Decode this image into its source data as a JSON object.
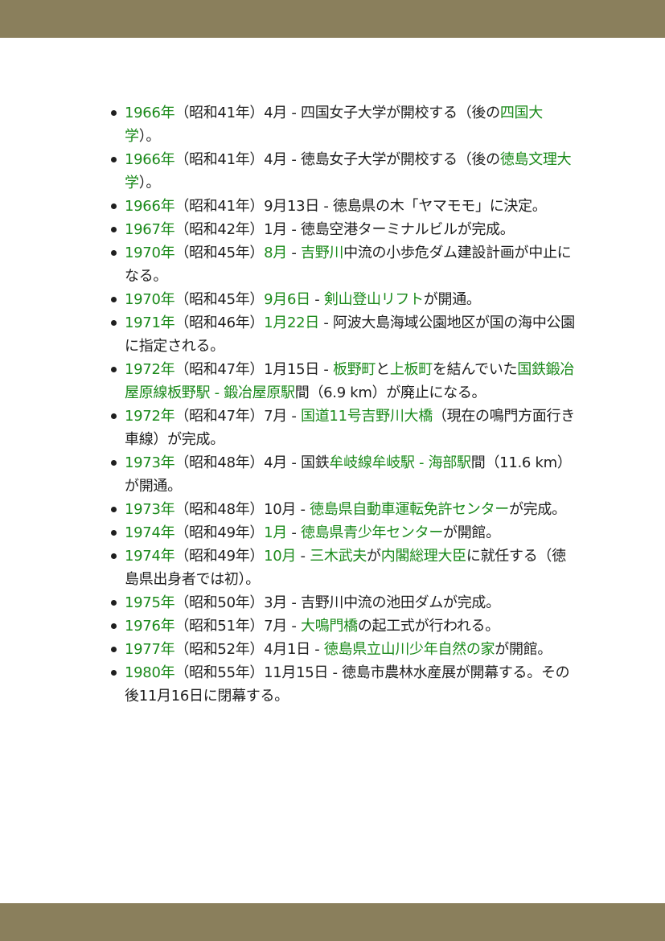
{
  "timeline": {
    "entries": [
      {
        "segments": [
          {
            "text": "1966年",
            "link": true
          },
          {
            "text": "（昭和41年）4月 - 四国女子大学が開校する（後の"
          },
          {
            "text": "四国大学",
            "link": true
          },
          {
            "text": "）。"
          }
        ]
      },
      {
        "segments": [
          {
            "text": "1966年",
            "link": true
          },
          {
            "text": "（昭和41年）4月 - 徳島女子大学が開校する（後の"
          },
          {
            "text": "徳島文理大学",
            "link": true
          },
          {
            "text": "）。"
          }
        ]
      },
      {
        "segments": [
          {
            "text": "1966年",
            "link": true
          },
          {
            "text": "（昭和41年）9月13日 - 徳島県の木「ヤマモモ」に決定。"
          }
        ]
      },
      {
        "segments": [
          {
            "text": "1967年",
            "link": true
          },
          {
            "text": "（昭和42年）1月 - 徳島空港ターミナルビルが完成。"
          }
        ]
      },
      {
        "segments": [
          {
            "text": "1970年",
            "link": true
          },
          {
            "text": "（昭和45年）"
          },
          {
            "text": "8月",
            "link": true
          },
          {
            "text": " - "
          },
          {
            "text": "吉野川",
            "link": true
          },
          {
            "text": "中流の小歩危ダム建設計画が中止になる。"
          }
        ]
      },
      {
        "segments": [
          {
            "text": "1970年",
            "link": true
          },
          {
            "text": "（昭和45年）"
          },
          {
            "text": "9月6日",
            "link": true
          },
          {
            "text": " - "
          },
          {
            "text": "剣山登山リフト",
            "link": true
          },
          {
            "text": "が開通。"
          }
        ]
      },
      {
        "segments": [
          {
            "text": "1971年",
            "link": true
          },
          {
            "text": "（昭和46年）"
          },
          {
            "text": "1月22日",
            "link": true
          },
          {
            "text": " - 阿波大島海域公園地区が国の海中公園に指定される。"
          }
        ]
      },
      {
        "segments": [
          {
            "text": "1972年",
            "link": true
          },
          {
            "text": "（昭和47年）1月15日 - "
          },
          {
            "text": "板野町",
            "link": true
          },
          {
            "text": "と"
          },
          {
            "text": "上板町",
            "link": true
          },
          {
            "text": "を結んでいた"
          },
          {
            "text": "国鉄鍛冶屋原線板野駅 - 鍛冶屋原駅",
            "link": true
          },
          {
            "text": "間（6.9 km）が廃止になる。"
          }
        ]
      },
      {
        "segments": [
          {
            "text": "1972年",
            "link": true
          },
          {
            "text": "（昭和47年）7月 - "
          },
          {
            "text": "国道11号吉野川大橋",
            "link": true
          },
          {
            "text": "（現在の鳴門方面行き車線）が完成。"
          }
        ]
      },
      {
        "segments": [
          {
            "text": "1973年",
            "link": true
          },
          {
            "text": "（昭和48年）4月 - 国鉄"
          },
          {
            "text": "牟岐線牟岐駅 - 海部駅",
            "link": true
          },
          {
            "text": "間（11.6 km）が開通。"
          }
        ]
      },
      {
        "segments": [
          {
            "text": "1973年",
            "link": true
          },
          {
            "text": "（昭和48年）10月 - "
          },
          {
            "text": "徳島県自動車運転免許センター",
            "link": true
          },
          {
            "text": "が完成。"
          }
        ]
      },
      {
        "segments": [
          {
            "text": "1974年",
            "link": true
          },
          {
            "text": "（昭和49年）"
          },
          {
            "text": "1月",
            "link": true
          },
          {
            "text": " - "
          },
          {
            "text": "徳島県青少年センター",
            "link": true
          },
          {
            "text": "が開館。"
          }
        ]
      },
      {
        "segments": [
          {
            "text": "1974年",
            "link": true
          },
          {
            "text": "（昭和49年）"
          },
          {
            "text": "10月",
            "link": true
          },
          {
            "text": " - "
          },
          {
            "text": "三木武夫",
            "link": true
          },
          {
            "text": "が"
          },
          {
            "text": "内閣総理大臣",
            "link": true
          },
          {
            "text": "に就任する（徳島県出身者では初）。"
          }
        ]
      },
      {
        "segments": [
          {
            "text": "1975年",
            "link": true
          },
          {
            "text": "（昭和50年）3月 - 吉野川中流の池田ダムが完成。"
          }
        ]
      },
      {
        "segments": [
          {
            "text": "1976年",
            "link": true
          },
          {
            "text": "（昭和51年）7月 - "
          },
          {
            "text": "大鳴門橋",
            "link": true
          },
          {
            "text": "の起工式が行われる。"
          }
        ]
      },
      {
        "segments": [
          {
            "text": "1977年",
            "link": true
          },
          {
            "text": "（昭和52年）4月1日 - "
          },
          {
            "text": "徳島県立山川少年自然の家",
            "link": true
          },
          {
            "text": "が開館。"
          }
        ]
      },
      {
        "segments": [
          {
            "text": "1980年",
            "link": true
          },
          {
            "text": "（昭和55年）11月15日 - 徳島市農林水産展が開幕する。その後11月16日に閉幕する。"
          }
        ]
      }
    ]
  }
}
